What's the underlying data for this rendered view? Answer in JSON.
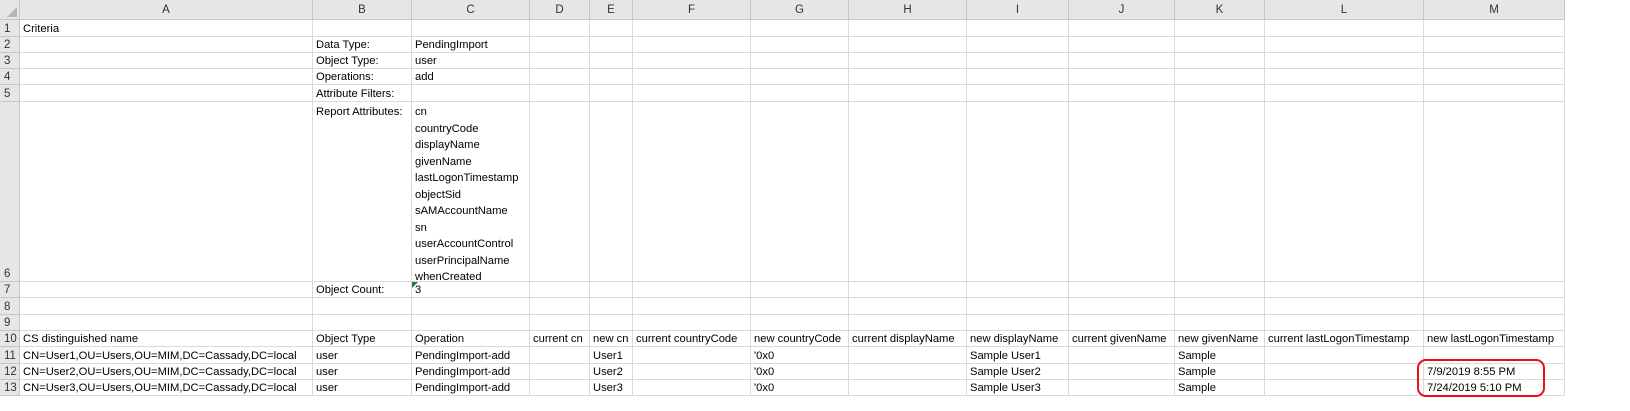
{
  "columns": [
    "A",
    "B",
    "C",
    "D",
    "E",
    "F",
    "G",
    "H",
    "I",
    "J",
    "K",
    "L",
    "M"
  ],
  "rows": [
    "1",
    "2",
    "3",
    "4",
    "5",
    "6",
    "7",
    "8",
    "9",
    "10",
    "11",
    "12",
    "13"
  ],
  "criteria_title": "Criteria",
  "criteria": {
    "data_type_label": "Data Type:",
    "data_type_value": "PendingImport",
    "object_type_label": "Object Type:",
    "object_type_value": "user",
    "operations_label": "Operations:",
    "operations_value": "add",
    "attribute_filters_label": "Attribute Filters:",
    "report_attributes_label": "Report Attributes:",
    "report_attributes": [
      "cn",
      "countryCode",
      "displayName",
      "givenName",
      "lastLogonTimestamp",
      "objectSid",
      "sAMAccountName",
      "sn",
      "userAccountControl",
      "userPrincipalName",
      "whenCreated"
    ],
    "object_count_label": "Object Count:",
    "object_count_value": "3"
  },
  "table": {
    "headers": [
      "CS distinguished name",
      "Object Type",
      "Operation",
      "current cn",
      "new cn",
      "current countryCode",
      "new countryCode",
      "current displayName",
      "new displayName",
      "current givenName",
      "new givenName",
      "current lastLogonTimestamp",
      "new lastLogonTimestamp"
    ],
    "rows": [
      [
        "CN=User1,OU=Users,OU=MIM,DC=Cassady,DC=local",
        "user",
        "PendingImport-add",
        "",
        "User1",
        "",
        "'0x0",
        "",
        "Sample User1",
        "",
        "Sample",
        "",
        ""
      ],
      [
        "CN=User2,OU=Users,OU=MIM,DC=Cassady,DC=local",
        "user",
        "PendingImport-add",
        "",
        "User2",
        "",
        "'0x0",
        "",
        "Sample User2",
        "",
        "Sample",
        "",
        "7/9/2019 8:55 PM"
      ],
      [
        "CN=User3,OU=Users,OU=MIM,DC=Cassady,DC=local",
        "user",
        "PendingImport-add",
        "",
        "User3",
        "",
        "'0x0",
        "",
        "Sample User3",
        "",
        "Sample",
        "",
        "7/24/2019 5:10 PM"
      ]
    ]
  },
  "colors": {
    "header_bg": "#e6e6e6",
    "grid": "#dadada",
    "annotation": "#e8101a",
    "error_indicator": "#1e7b3a"
  }
}
